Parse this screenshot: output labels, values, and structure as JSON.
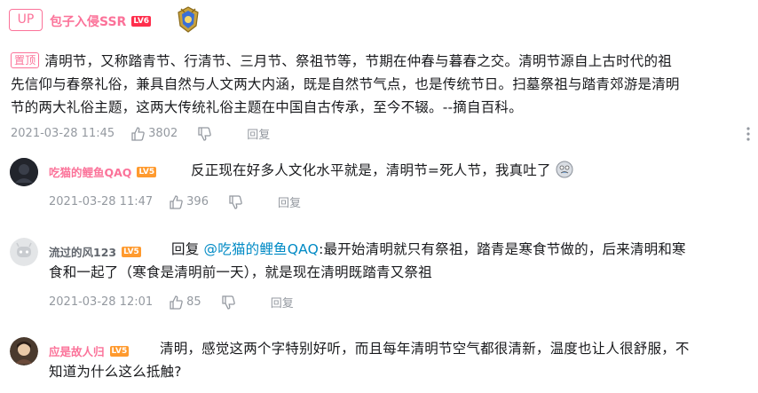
{
  "top_comment": {
    "up_label": "UP",
    "username": "包子入侵SSR",
    "level": "LV6",
    "pin_label": "置顶",
    "text_line1": "清明节，又称踏青节、行清节、三月节、祭祖节等，节期在仲春与暮春之交。清明节源自上古时代的祖",
    "text_line2": "先信仰与春祭礼俗，兼具自然与人文两大内涵，既是自然节气点，也是传统节日。扫墓祭祖与踏青郊游是清明",
    "text_line3": "节的两大礼俗主题，这两大传统礼俗主题在中国自古传承，至今不辍。--摘自百科。",
    "time": "2021-03-28 11:45",
    "likes": "3802",
    "reply_label": "回复"
  },
  "comments": [
    {
      "username": "吃猫的鲤鱼QAQ",
      "level": "LV5",
      "text": "反正现在好多人文化水平就是，清明节=死人节，我真吐了",
      "time": "2021-03-28 11:47",
      "likes": "396",
      "reply_label": "回复"
    },
    {
      "username": "流过的风123",
      "level": "LV5",
      "reply_prefix": "回复",
      "mention": "@吃猫的鲤鱼QAQ",
      "text_line1": ":最开始清明就只有祭祖，踏青是寒食节做的，后来清明和寒",
      "text_line2": "食和一起了（寒食是清明前一天），就是现在清明既踏青又祭祖",
      "time": "2021-03-28 12:01",
      "likes": "85",
      "reply_label": "回复"
    },
    {
      "username": "应是故人归",
      "level": "LV5",
      "text_line1": "清明，感觉这两个字特别好听，而且每年清明节空气都很清新，温度也让人很舒服，不",
      "text_line2": "知道为什么这么抵触?"
    }
  ],
  "colors": {
    "pink": "#fb7299",
    "gray_text": "#9499a0",
    "mention_blue": "#008ac5",
    "level6": "#ff2e4c",
    "level5": "#ff9a2e"
  }
}
